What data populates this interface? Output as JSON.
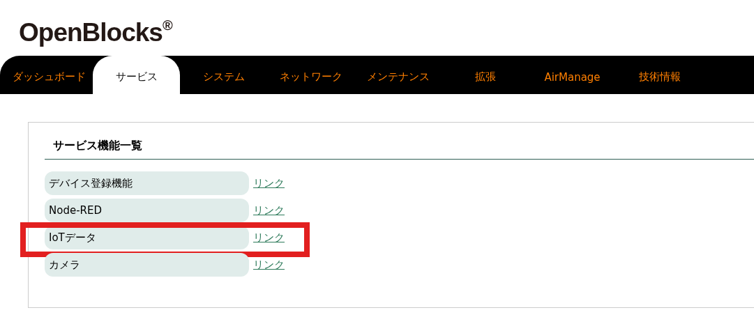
{
  "logo": {
    "name": "OpenBlocks",
    "mark": "®"
  },
  "tabs": [
    {
      "label": "ダッシュボード",
      "selected": false
    },
    {
      "label": "サービス",
      "selected": true
    },
    {
      "label": "システム",
      "selected": false
    },
    {
      "label": "ネットワーク",
      "selected": false
    },
    {
      "label": "メンテナンス",
      "selected": false
    },
    {
      "label": "拡張",
      "selected": false
    },
    {
      "label": "AirManage",
      "selected": false
    },
    {
      "label": "技術情報",
      "selected": false
    }
  ],
  "panel": {
    "title": "サービス機能一覧",
    "services": [
      {
        "name": "デバイス登録機能",
        "link": "リンク",
        "highlighted": false
      },
      {
        "name": "Node-RED",
        "link": "リンク",
        "highlighted": false
      },
      {
        "name": "IoTデータ",
        "link": "リンク",
        "highlighted": true
      },
      {
        "name": "カメラ",
        "link": "リンク",
        "highlighted": false
      }
    ]
  }
}
